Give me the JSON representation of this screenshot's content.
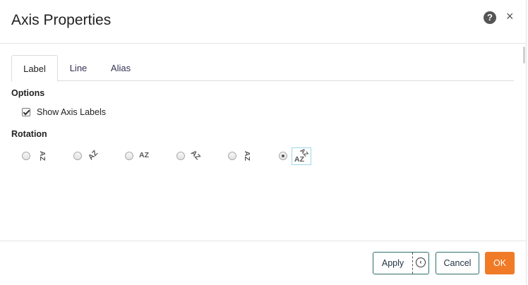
{
  "dialog": {
    "title": "Axis Properties",
    "help_icon_glyph": "?",
    "close_icon_glyph": "×"
  },
  "tabs": [
    {
      "label": "Label",
      "active": true
    },
    {
      "label": "Line",
      "active": false
    },
    {
      "label": "Alias",
      "active": false
    }
  ],
  "options": {
    "heading": "Options",
    "show_axis_labels": {
      "label": "Show Axis Labels",
      "checked": true
    }
  },
  "rotation": {
    "heading": "Rotation",
    "choices": [
      {
        "text": "AZ",
        "angle": -90,
        "selected": false
      },
      {
        "text": "AZ",
        "angle": -45,
        "selected": false
      },
      {
        "text": "AZ",
        "angle": 0,
        "selected": false
      },
      {
        "text": "AZ",
        "angle": 45,
        "selected": false
      },
      {
        "text": "AZ",
        "angle": 90,
        "selected": false
      },
      {
        "text": "AZ",
        "angle": "auto",
        "selected": true
      }
    ]
  },
  "footer": {
    "apply_label": "Apply",
    "cancel_label": "Cancel",
    "ok_label": "OK"
  },
  "colors": {
    "accent": "#f07a26",
    "button_border": "#2f6d6d"
  }
}
